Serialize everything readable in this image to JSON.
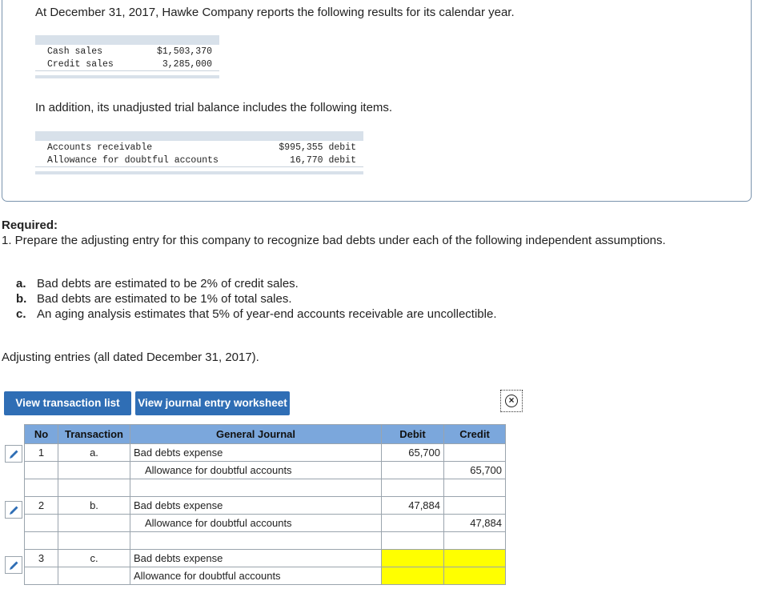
{
  "intro": "At December 31, 2017, Hawke Company reports the following results for its calendar year.",
  "sales_table": [
    {
      "label": "Cash sales",
      "value": "$1,503,370"
    },
    {
      "label": "Credit sales",
      "value": "3,285,000"
    }
  ],
  "trial_intro": "In addition, its unadjusted trial balance includes the following items.",
  "trial_table": [
    {
      "label": "Accounts receivable",
      "value": "$995,355 debit"
    },
    {
      "label": "Allowance for doubtful accounts",
      "value": "16,770 debit"
    }
  ],
  "required": {
    "title": "Required:",
    "text": "1. Prepare the adjusting entry for this company to recognize bad debts under each of the following independent assumptions.",
    "items": [
      {
        "letter": "a.",
        "text": "Bad debts are estimated to be 2% of credit sales."
      },
      {
        "letter": "b.",
        "text": "Bad debts are estimated to be 1% of total sales."
      },
      {
        "letter": "c.",
        "text": "An aging analysis estimates that 5% of year-end accounts receivable are uncollectible."
      }
    ]
  },
  "adjusting_heading": "Adjusting entries (all dated December 31, 2017).",
  "buttons": {
    "transaction_list": "View transaction list",
    "journal_worksheet": "View journal entry worksheet"
  },
  "journal": {
    "headers": {
      "no": "No",
      "transaction": "Transaction",
      "general_journal": "General Journal",
      "debit": "Debit",
      "credit": "Credit"
    },
    "entries": [
      {
        "no": "1",
        "transaction": "a.",
        "debit_account": "Bad debts expense",
        "credit_account": "Allowance for doubtful accounts",
        "debit": "65,700",
        "credit": "65,700"
      },
      {
        "no": "2",
        "transaction": "b.",
        "debit_account": "Bad debts expense",
        "credit_account": "Allowance for doubtful accounts",
        "debit": "47,884",
        "credit": "47,884"
      },
      {
        "no": "3",
        "transaction": "c.",
        "debit_account": "Bad debts expense",
        "credit_account": "Allowance for doubtful accounts",
        "debit": "",
        "credit": ""
      }
    ]
  },
  "colors": {
    "button": "#2f6eb5",
    "header": "#7ba7dc",
    "highlight": "#ffff00"
  }
}
